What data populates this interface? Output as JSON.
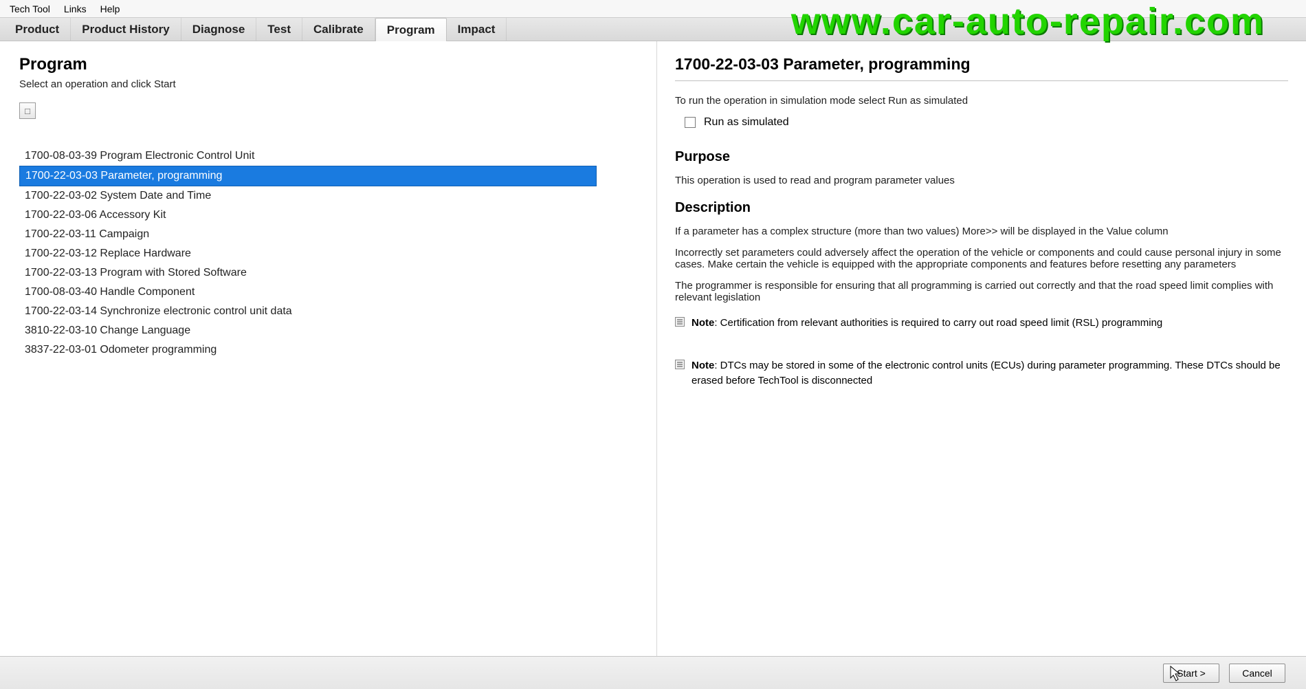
{
  "menu": {
    "items": [
      "Tech Tool",
      "Links",
      "Help"
    ]
  },
  "tabs": {
    "items": [
      "Product",
      "Product History",
      "Diagnose",
      "Test",
      "Calibrate",
      "Program",
      "Impact"
    ],
    "active": 5
  },
  "watermark": "www.car-auto-repair.com",
  "left": {
    "title": "Program",
    "subtitle": "Select an operation and click Start",
    "collapse_glyph": "□",
    "operations": [
      "1700-08-03-39 Program Electronic Control Unit",
      "1700-22-03-03 Parameter, programming",
      "1700-22-03-02 System Date and Time",
      "1700-22-03-06 Accessory Kit",
      "1700-22-03-11 Campaign",
      "1700-22-03-12 Replace Hardware",
      "1700-22-03-13 Program with Stored Software",
      "1700-08-03-40 Handle Component",
      "1700-22-03-14 Synchronize electronic control unit data",
      "3810-22-03-10 Change Language",
      "3837-22-03-01 Odometer programming"
    ],
    "selected": 1
  },
  "right": {
    "title": "1700-22-03-03 Parameter, programming",
    "sim_intro": "To run the operation in simulation mode select Run as simulated",
    "sim_label": "Run as simulated",
    "purpose_h": "Purpose",
    "purpose_text": "This operation is used to read and program parameter values",
    "desc_h": "Description",
    "desc_p1": "If a parameter has a complex structure (more than two values) More>> will be displayed in the Value column",
    "desc_p2": "Incorrectly set parameters could adversely affect the operation of the vehicle or components and could cause personal injury in some cases. Make certain the vehicle is equipped with the appropriate components and features before resetting any parameters",
    "desc_p3": "The programmer is responsible for ensuring that all programming is carried out correctly and that the road speed limit complies with relevant legislation",
    "note_label": "Note",
    "note1": ": Certification from relevant authorities is required to carry out road speed limit (RSL) programming",
    "note2": ": DTCs may be stored in some of the electronic control units (ECUs) during parameter programming. These DTCs should be erased before TechTool is disconnected"
  },
  "footer": {
    "start": "Start >",
    "cancel": "Cancel"
  }
}
